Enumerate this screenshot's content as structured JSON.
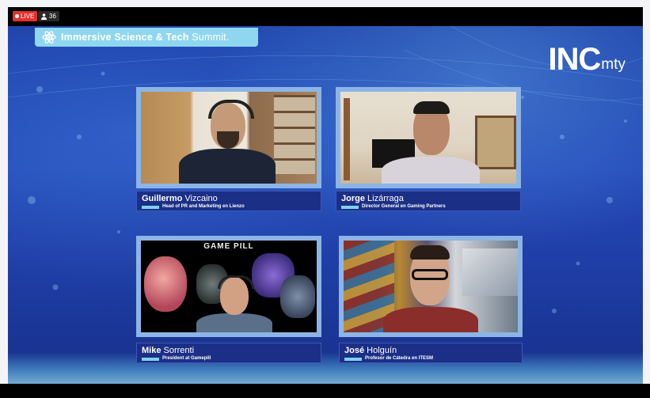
{
  "stream": {
    "live_label": "LIVE",
    "viewer_count": "36",
    "icons": {
      "live": "live-dot-icon",
      "viewers": "person-icon"
    }
  },
  "banner": {
    "title_bold": "Immersive Science & Tech",
    "title_thin": "Summit."
  },
  "logo": {
    "main": "INC",
    "suffix": "mty"
  },
  "colors": {
    "stage_blue": "#2449b8",
    "tile_border": "#8cb5e6",
    "nameplate_bg": "#1b2f86",
    "accent_cyan": "#7fd1f0",
    "live_red": "#e5322d"
  },
  "participants": [
    {
      "first": "Guillermo",
      "last": "Vizcaino",
      "title": "Head of PR and Marketing en Lienzo"
    },
    {
      "first": "Jorge",
      "last": "Lizárraga",
      "title": "Director General en Gaming Partners"
    },
    {
      "first": "Mike",
      "last": "Sorrenti",
      "title": "President at Gamepill",
      "video_text": "GAME PILL"
    },
    {
      "first": "José",
      "last": "Holguín",
      "title": "Profesor de Cátedra en ITESM"
    }
  ]
}
